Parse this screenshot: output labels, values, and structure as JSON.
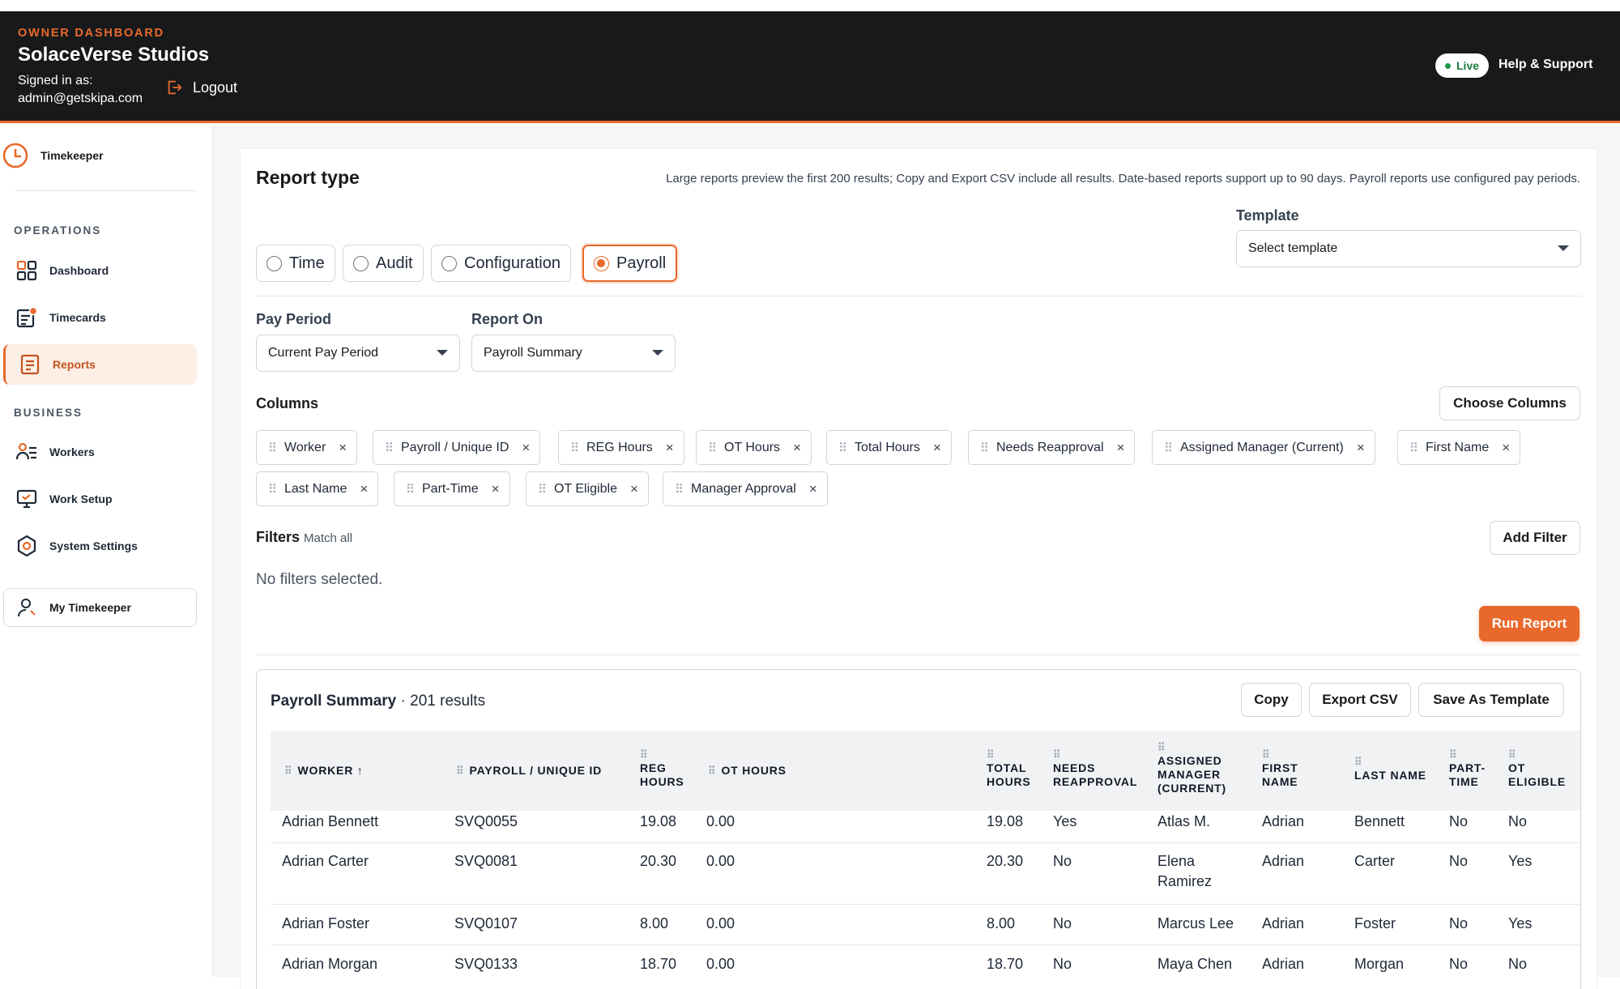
{
  "header": {
    "kicker": "OWNER DASHBOARD",
    "org_name": "SolaceVerse Studios",
    "signed_in_label": "Signed in as:",
    "signed_in_email": "admin@getskipa.com",
    "logout_label": "Logout",
    "live_label": "Live",
    "help_label": "Help & Support",
    "accent_color": "#e8692b"
  },
  "sidebar": {
    "brand": "Timekeeper",
    "operations_label": "OPERATIONS",
    "operations": [
      {
        "label": "Dashboard",
        "icon": "dashboard-icon"
      },
      {
        "label": "Timecards",
        "icon": "timecards-icon"
      },
      {
        "label": "Reports",
        "icon": "reports-icon",
        "active": true
      }
    ],
    "business_label": "BUSINESS",
    "business": [
      {
        "label": "Workers",
        "icon": "workers-icon"
      },
      {
        "label": "Work Setup",
        "icon": "work-setup-icon"
      },
      {
        "label": "System Settings",
        "icon": "settings-icon"
      }
    ],
    "my_timekeeper": "My Timekeeper"
  },
  "report": {
    "title": "Report type",
    "note": "Large reports preview the first 200 results; Copy and Export CSV include all results. Date-based reports support up to 90 days. Payroll reports use configured pay periods.",
    "types": [
      "Time",
      "Audit",
      "Configuration",
      "Payroll"
    ],
    "selected_type": "Payroll",
    "template_label": "Template",
    "template_value": "Select template",
    "pay_period_label": "Pay Period",
    "pay_period_value": "Current Pay Period",
    "report_on_label": "Report On",
    "report_on_value": "Payroll Summary",
    "columns_label": "Columns",
    "choose_columns": "Choose Columns",
    "columns": [
      "Worker",
      "Payroll / Unique ID",
      "REG Hours",
      "OT Hours",
      "Total Hours",
      "Needs Reapproval",
      "Assigned Manager (Current)",
      "First Name",
      "Last Name",
      "Part-Time",
      "OT Eligible",
      "Manager Approval"
    ],
    "filters_label": "Filters",
    "filters_mode": "Match all",
    "add_filter": "Add Filter",
    "no_filters": "No filters selected.",
    "run_report": "Run Report"
  },
  "results": {
    "title": "Payroll Summary",
    "count_text": "· 201 results",
    "copy": "Copy",
    "export": "Export CSV",
    "save_template": "Save As Template",
    "headers": {
      "worker": "WORKER ↑",
      "payroll_id": "PAYROLL / UNIQUE ID",
      "reg_hours_1": "REG",
      "reg_hours_2": "HOURS",
      "ot_hours": "OT HOURS",
      "total_hours_1": "TOTAL",
      "total_hours_2": "HOURS",
      "needs_1": "NEEDS",
      "needs_2": "REAPPROVAL",
      "mgr_1": "ASSIGNED",
      "mgr_2": "MANAGER",
      "mgr_3": "(CURRENT)",
      "first_1": "FIRST",
      "first_2": "NAME",
      "last_name": "LAST NAME",
      "part_1": "PART-",
      "part_2": "TIME",
      "ot_elig_1": "OT",
      "ot_elig_2": "ELIGIBLE"
    },
    "rows": [
      {
        "worker": "Adrian Bennett",
        "id": "SVQ0055",
        "reg": "19.08",
        "ot": "0.00",
        "total": "19.08",
        "needs": "Yes",
        "mgr": "Atlas M.",
        "first": "Adrian",
        "last": "Bennett",
        "part": "No",
        "ot_elig": "No"
      },
      {
        "worker": "Adrian Carter",
        "id": "SVQ0081",
        "reg": "20.30",
        "ot": "0.00",
        "total": "20.30",
        "needs": "No",
        "mgr": "Elena Ramirez",
        "first": "Adrian",
        "last": "Carter",
        "part": "No",
        "ot_elig": "Yes"
      },
      {
        "worker": "Adrian Foster",
        "id": "SVQ0107",
        "reg": "8.00",
        "ot": "0.00",
        "total": "8.00",
        "needs": "No",
        "mgr": "Marcus Lee",
        "first": "Adrian",
        "last": "Foster",
        "part": "No",
        "ot_elig": "Yes"
      },
      {
        "worker": "Adrian Morgan",
        "id": "SVQ0133",
        "reg": "18.70",
        "ot": "0.00",
        "total": "18.70",
        "needs": "No",
        "mgr": "Maya Chen",
        "first": "Adrian",
        "last": "Morgan",
        "part": "No",
        "ot_elig": "No"
      }
    ]
  }
}
